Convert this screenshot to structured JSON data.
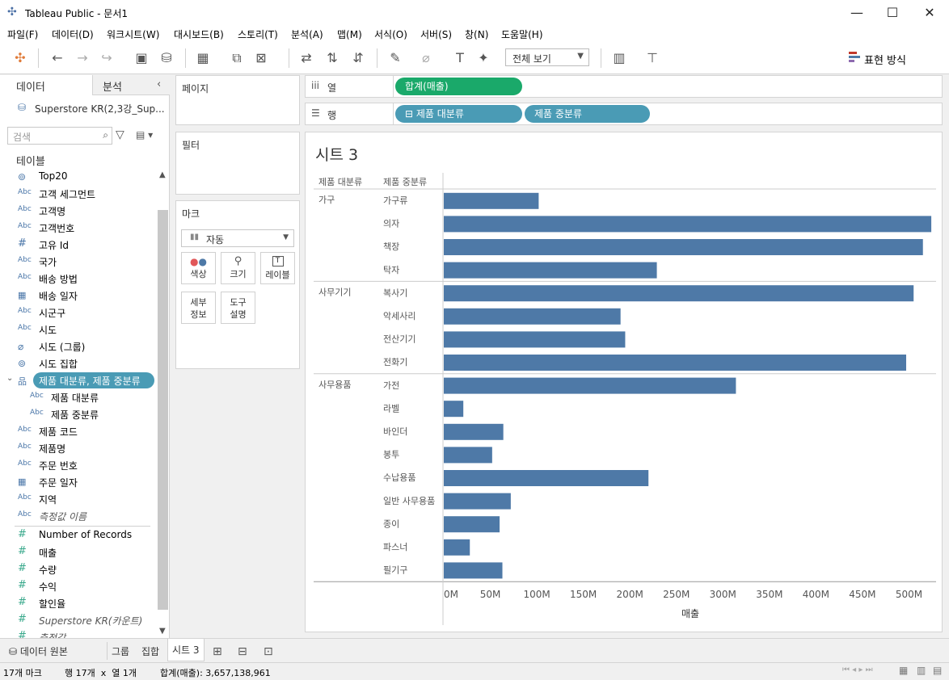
{
  "app": {
    "title": "Tableau Public - 문서1",
    "window_buttons": {
      "minimize": "—",
      "maximize": "☐",
      "close": "✕"
    }
  },
  "menu": [
    "파일(F)",
    "데이터(D)",
    "워크시트(W)",
    "대시보드(B)",
    "스토리(T)",
    "분석(A)",
    "맵(M)",
    "서식(O)",
    "서버(S)",
    "창(N)",
    "도움말(H)"
  ],
  "toolbar": {
    "view_select": "전체 보기",
    "show_me": "표현 방식"
  },
  "datapane": {
    "tab_data": "데이터",
    "tab_analysis": "분석",
    "datasource": "Superstore KR(2,3강_Sup...",
    "search_placeholder": "검색",
    "tables_label": "테이블",
    "fields": [
      {
        "icon": "link",
        "label": "Top20"
      },
      {
        "icon": "Abc",
        "label": "고객 세그먼트"
      },
      {
        "icon": "Abc",
        "label": "고객명"
      },
      {
        "icon": "Abc",
        "label": "고객번호"
      },
      {
        "icon": "#",
        "label": "고유 Id"
      },
      {
        "icon": "Abc",
        "label": "국가"
      },
      {
        "icon": "Abc",
        "label": "배송 방법"
      },
      {
        "icon": "cal",
        "label": "배송 일자"
      },
      {
        "icon": "Abc",
        "label": "시군구"
      },
      {
        "icon": "Abc",
        "label": "시도"
      },
      {
        "icon": "clip",
        "label": "시도 (그룹)"
      },
      {
        "icon": "link",
        "label": "시도 집합"
      },
      {
        "icon": "hier",
        "label": "제품 대분류, 제품 중분류"
      },
      {
        "icon": "Abc",
        "label": "제품 대분류"
      },
      {
        "icon": "Abc",
        "label": "제품 중분류"
      },
      {
        "icon": "Abc",
        "label": "제품 코드"
      },
      {
        "icon": "Abc",
        "label": "제품명"
      },
      {
        "icon": "Abc",
        "label": "주문 번호"
      },
      {
        "icon": "cal",
        "label": "주문 일자"
      },
      {
        "icon": "Abc",
        "label": "지역"
      },
      {
        "icon": "Abc",
        "label": "측정값 이름"
      },
      {
        "icon": "#",
        "label": "Number of Records"
      },
      {
        "icon": "#",
        "label": "매출"
      },
      {
        "icon": "#",
        "label": "수량"
      },
      {
        "icon": "#",
        "label": "수익"
      },
      {
        "icon": "#",
        "label": "할인율"
      },
      {
        "icon": "#",
        "label": "Superstore KR(카운트)"
      },
      {
        "icon": "#",
        "label": "측정값"
      }
    ]
  },
  "cards": {
    "pages": "페이지",
    "filters": "필터",
    "marks": "마크",
    "marks_type": "자동",
    "mark_buttons": [
      "색상",
      "크기",
      "레이블",
      "세부\n정보",
      "도구\n설명"
    ]
  },
  "shelves": {
    "columns_label": "열",
    "rows_label": "행",
    "column_pills": [
      "합계(매출)"
    ],
    "row_pills": [
      "⊟ 제품 대분류",
      "제품 중분류"
    ]
  },
  "sheet": {
    "title": "시트 3",
    "header_col1": "제품 대분류",
    "header_col2": "제품 중분류"
  },
  "chart_data": {
    "type": "bar",
    "orientation": "horizontal",
    "xlabel": "매출",
    "xlim": [
      0,
      530000000
    ],
    "x_ticks": [
      "0M",
      "50M",
      "100M",
      "150M",
      "200M",
      "250M",
      "300M",
      "350M",
      "400M",
      "450M",
      "500M"
    ],
    "bar_color": "#4e79a7",
    "groups": [
      {
        "name": "가구",
        "categories": [
          "가구류",
          "의자",
          "책장",
          "탁자"
        ],
        "values": [
          102000000,
          524000000,
          515000000,
          229000000
        ]
      },
      {
        "name": "사무기기",
        "categories": [
          "복사기",
          "악세사리",
          "전산기기",
          "전화기"
        ],
        "values": [
          505000000,
          190000000,
          195000000,
          497000000
        ]
      },
      {
        "name": "사무용품",
        "categories": [
          "가전",
          "라벨",
          "바인더",
          "봉투",
          "수납용품",
          "일반 사무용품",
          "종이",
          "파스너",
          "필기구"
        ],
        "values": [
          314000000,
          21000000,
          64000000,
          52000000,
          220000000,
          72000000,
          60000000,
          28000000,
          63000000
        ]
      }
    ]
  },
  "sheet_tabs": [
    "데이터 원본",
    "그룹",
    "집합",
    "시트 3"
  ],
  "status": {
    "marks": "17개 마크",
    "rows_cols": "행 17개  x  열 1개",
    "sum": "합계(매출): 3,657,138,961"
  }
}
